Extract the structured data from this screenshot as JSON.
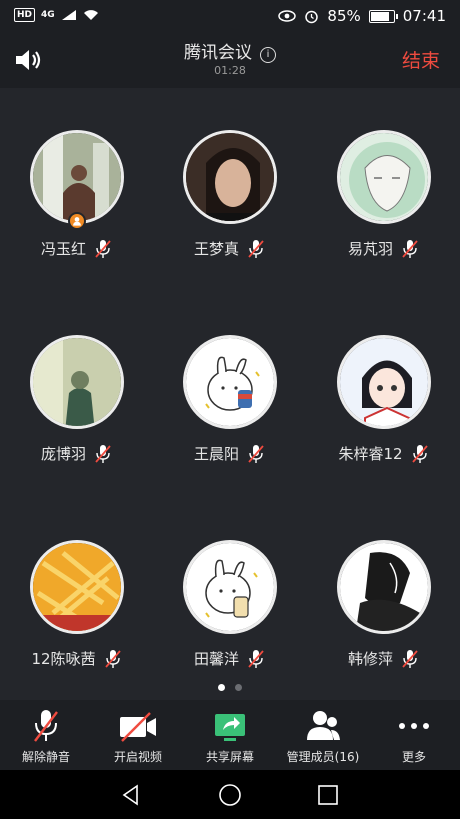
{
  "status_bar": {
    "left_icons": [
      "HD",
      "4G"
    ],
    "battery": "85%",
    "battery_level": 0.85,
    "time": "07:41"
  },
  "header": {
    "title": "腾讯会议",
    "elapsed": "01:28",
    "end_label": "结束"
  },
  "participants": [
    {
      "name": "冯玉红",
      "host": true
    },
    {
      "name": "王梦真",
      "host": false
    },
    {
      "name": "易芃羽",
      "host": false
    },
    {
      "name": "庞博羽",
      "host": false
    },
    {
      "name": "王晨阳",
      "host": false
    },
    {
      "name": "朱梓睿12",
      "host": false
    },
    {
      "name": "12陈咏茜",
      "host": false
    },
    {
      "name": "田馨洋",
      "host": false
    },
    {
      "name": "韩修萍",
      "host": false
    }
  ],
  "pager": {
    "pages": 2,
    "current": 1
  },
  "toolbar": {
    "unmute": "解除静音",
    "start_video": "开启视频",
    "share_screen": "共享屏幕",
    "manage_members": "管理成员(16)",
    "more": "更多"
  },
  "colors": {
    "accent_red": "#ef4b3f",
    "share_green": "#3ac178",
    "host_orange": "#f08a24"
  }
}
